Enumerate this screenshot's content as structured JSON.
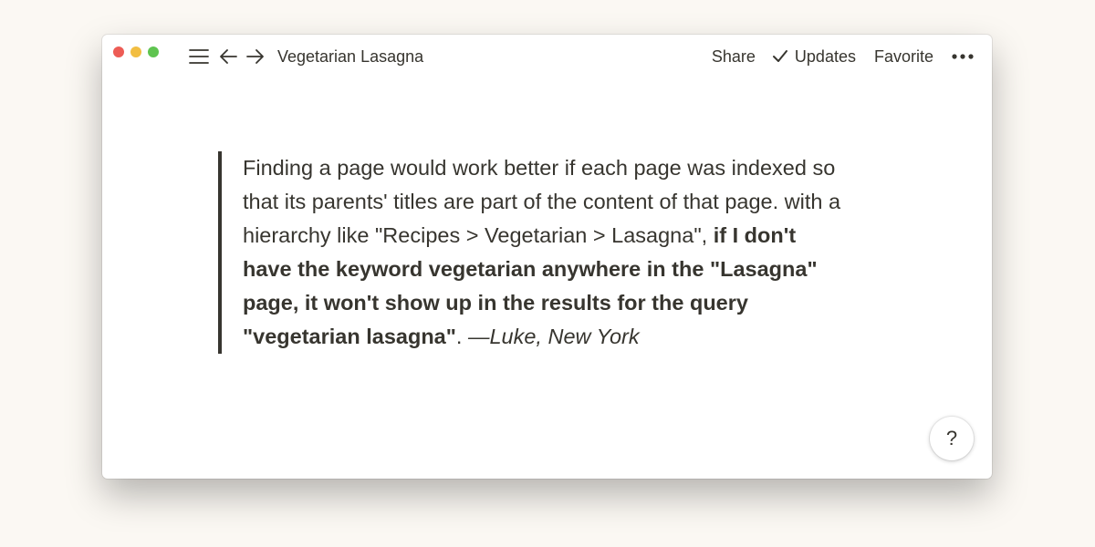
{
  "window": {
    "traffic_lights": {
      "close_color": "#ed5c55",
      "minimize_color": "#f2be42",
      "maximize_color": "#5fc450"
    }
  },
  "topbar": {
    "menu_icon": "hamburger-menu-icon",
    "back_icon": "arrow-left-icon",
    "forward_icon": "arrow-right-icon",
    "page_title": "Vegetarian Lasagna",
    "share_label": "Share",
    "updates_icon": "checkmark-icon",
    "updates_label": "Updates",
    "favorite_label": "Favorite",
    "more_icon": "more-dots-icon"
  },
  "quote": {
    "segment_1": "Finding a page would work better if each page was indexed so that its parents' titles are part of the content of that page. with a hierarchy like \"Recipes > Vegetarian > Lasagna\", ",
    "segment_2_bold": "if I don't have the keyword vegetarian anywhere in the \"Lasagna\" page, it won't show up in the results for the query \"vegetarian lasagna\"",
    "segment_3": ". ",
    "segment_4_italic": "—Luke, New York"
  },
  "help": {
    "label": "?"
  },
  "colors": {
    "background": "#fbf8f3",
    "text": "#37352f",
    "window": "#ffffff"
  }
}
